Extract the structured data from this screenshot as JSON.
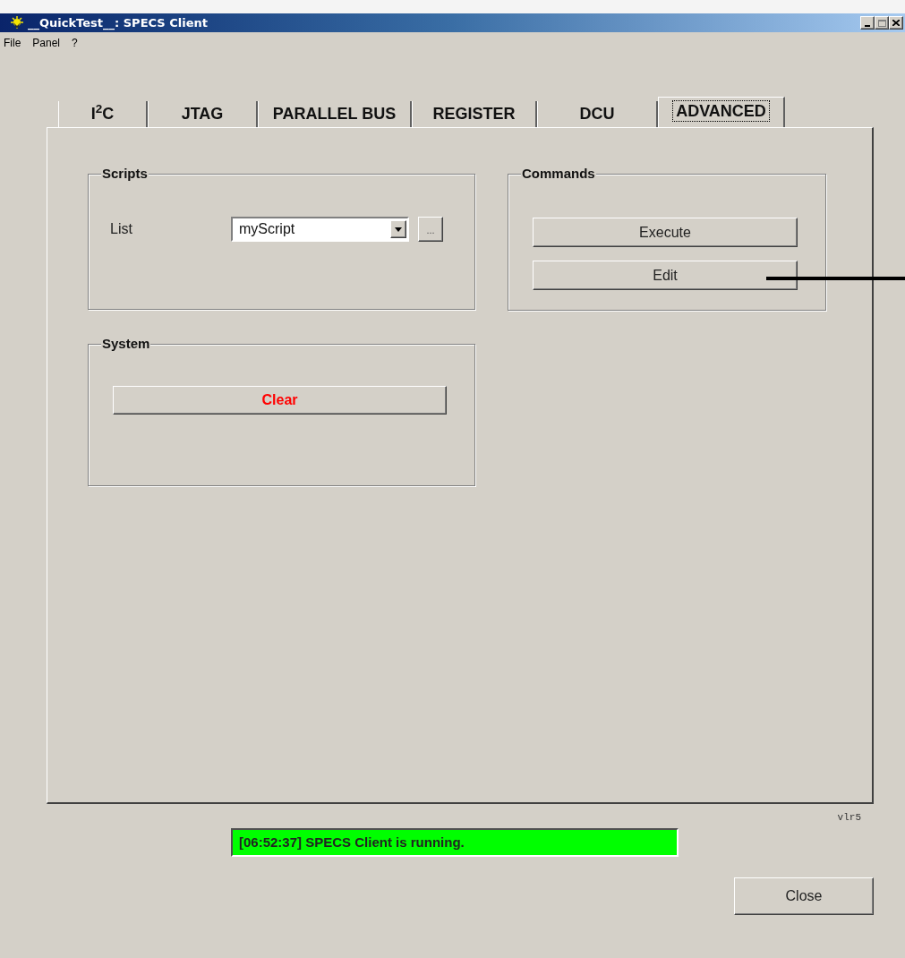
{
  "window": {
    "title": "__QuickTest__: SPECS Client"
  },
  "menu": [
    "File",
    "Panel",
    "?"
  ],
  "tabs": [
    {
      "label": "I$^{2}$C",
      "selected": false
    },
    {
      "label": "JTAG",
      "selected": false
    },
    {
      "label": "PARALLEL BUS",
      "selected": false
    },
    {
      "label": "REGISTER",
      "selected": false
    },
    {
      "label": "DCU",
      "selected": false
    },
    {
      "label": "ADVANCED",
      "selected": true
    }
  ],
  "scripts": {
    "title": "Scripts",
    "label": "List",
    "value": "myScript",
    "browse": "..."
  },
  "commands": {
    "title": "Commands",
    "buttons": [
      "Execute",
      "Edit"
    ]
  },
  "system": {
    "title": "System",
    "button": "Clear"
  },
  "version": "vlr5",
  "status": "[06:52:37] SPECS Client is running.",
  "close": "Close"
}
